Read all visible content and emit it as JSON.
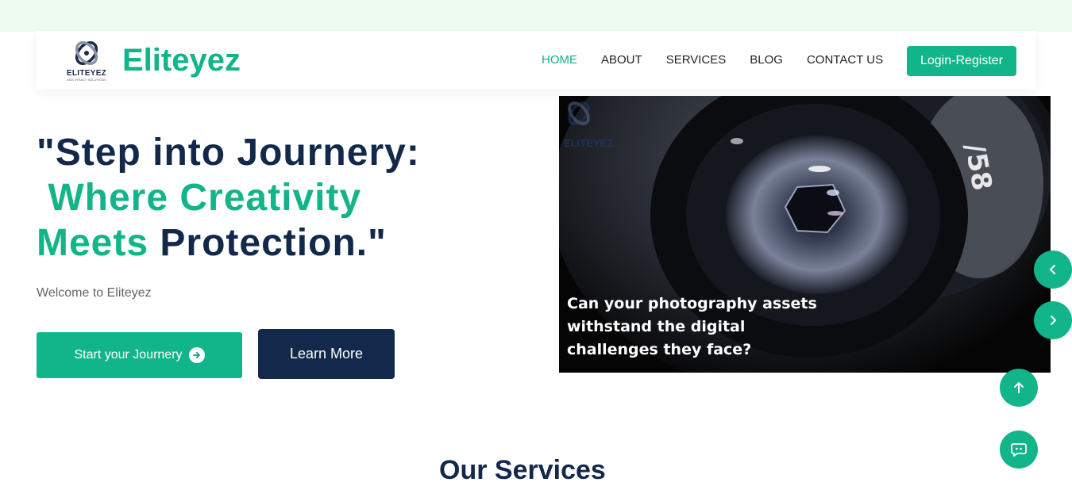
{
  "brand": {
    "logo_text": "ELITEYEZ",
    "logo_tagline": "ANTI-PIRACY SOLUTIONS",
    "name": "Eliteyez"
  },
  "nav": {
    "items": [
      {
        "label": "HOME",
        "active": true
      },
      {
        "label": "ABOUT",
        "active": false
      },
      {
        "label": "SERVICES",
        "active": false
      },
      {
        "label": "BLOG",
        "active": false
      },
      {
        "label": "CONTACT US",
        "active": false
      }
    ],
    "login_label": "Login-Register"
  },
  "hero": {
    "title_line1": "\"Step into Journery:",
    "title_green": "Where Creativity Meets",
    "title_end": "Protection.\"",
    "subtitle": "Welcome to Eliteyez",
    "primary_button": "Start your Journery",
    "secondary_button": "Learn More"
  },
  "slide": {
    "watermark": "ELITEYEZ",
    "caption": "Can your photography assets withstand the digital challenges they face?"
  },
  "icons": {
    "carousel_prev": "chevron-left-icon",
    "carousel_next": "chevron-right-icon",
    "scroll_top": "arrow-up-icon",
    "chat": "chat-icon",
    "start_arrow": "arrow-right-circle-icon"
  },
  "colors": {
    "accent": "#12b48a",
    "navy": "#13294b",
    "top_band": "#eefbf1"
  },
  "section": {
    "heading": "Our Services"
  }
}
